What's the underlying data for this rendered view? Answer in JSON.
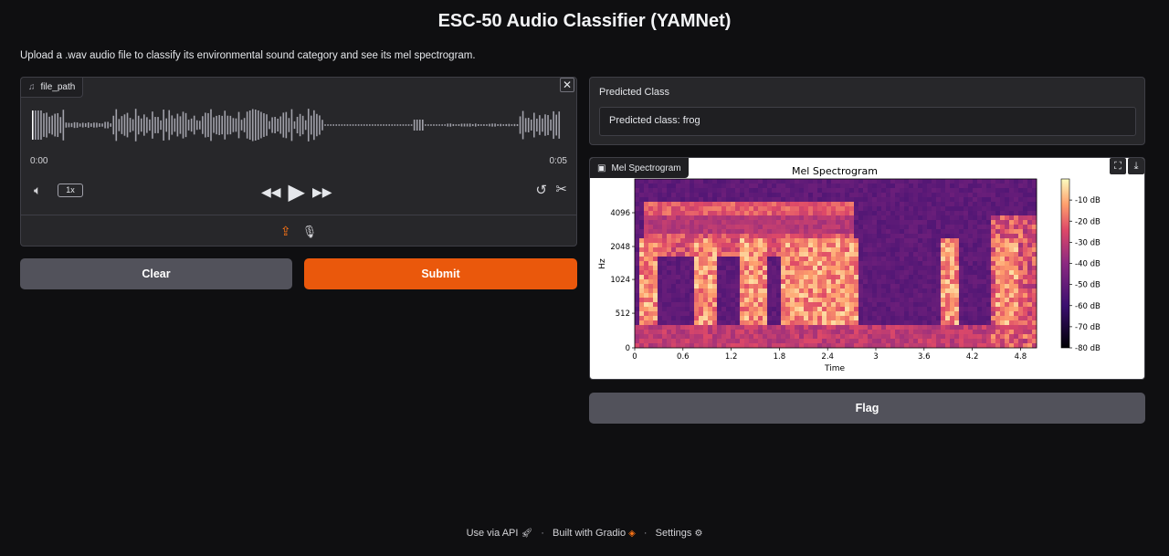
{
  "app": {
    "title": "ESC-50 Audio Classifier (YAMNet)",
    "description": "Upload a .wav audio file to classify its environmental sound category and see its mel spectrogram."
  },
  "audio": {
    "label": "file_path",
    "label_icon": "music-note-icon",
    "time_start": "0:00",
    "time_end": "0:05",
    "speed": "1x"
  },
  "buttons": {
    "clear": "Clear",
    "submit": "Submit",
    "flag": "Flag"
  },
  "prediction": {
    "label": "Predicted Class",
    "value": "Predicted class: frog"
  },
  "spectrogram": {
    "label": "Mel Spectrogram"
  },
  "chart_data": {
    "type": "heatmap",
    "title": "Mel Spectrogram",
    "xlabel": "Time",
    "ylabel": "Hz",
    "x_ticks": [
      "0",
      "0.6",
      "1.2",
      "1.8",
      "2.4",
      "3",
      "3.6",
      "4.2",
      "4.8"
    ],
    "y_ticks": [
      "0",
      "512",
      "1024",
      "2048",
      "4096"
    ],
    "xlim": [
      0,
      5
    ],
    "colorbar_label_ticks": [
      "-10 dB",
      "-20 dB",
      "-30 dB",
      "-40 dB",
      "-50 dB",
      "-60 dB",
      "-70 dB",
      "-80 dB"
    ],
    "colormap": "magma",
    "colorbar_range_db": [
      -80,
      0
    ]
  },
  "footer": {
    "api": "Use via API",
    "built": "Built with Gradio",
    "settings": "Settings"
  },
  "colors": {
    "accent": "#ea580c",
    "background": "#0f0f11",
    "panel": "#27272a"
  }
}
